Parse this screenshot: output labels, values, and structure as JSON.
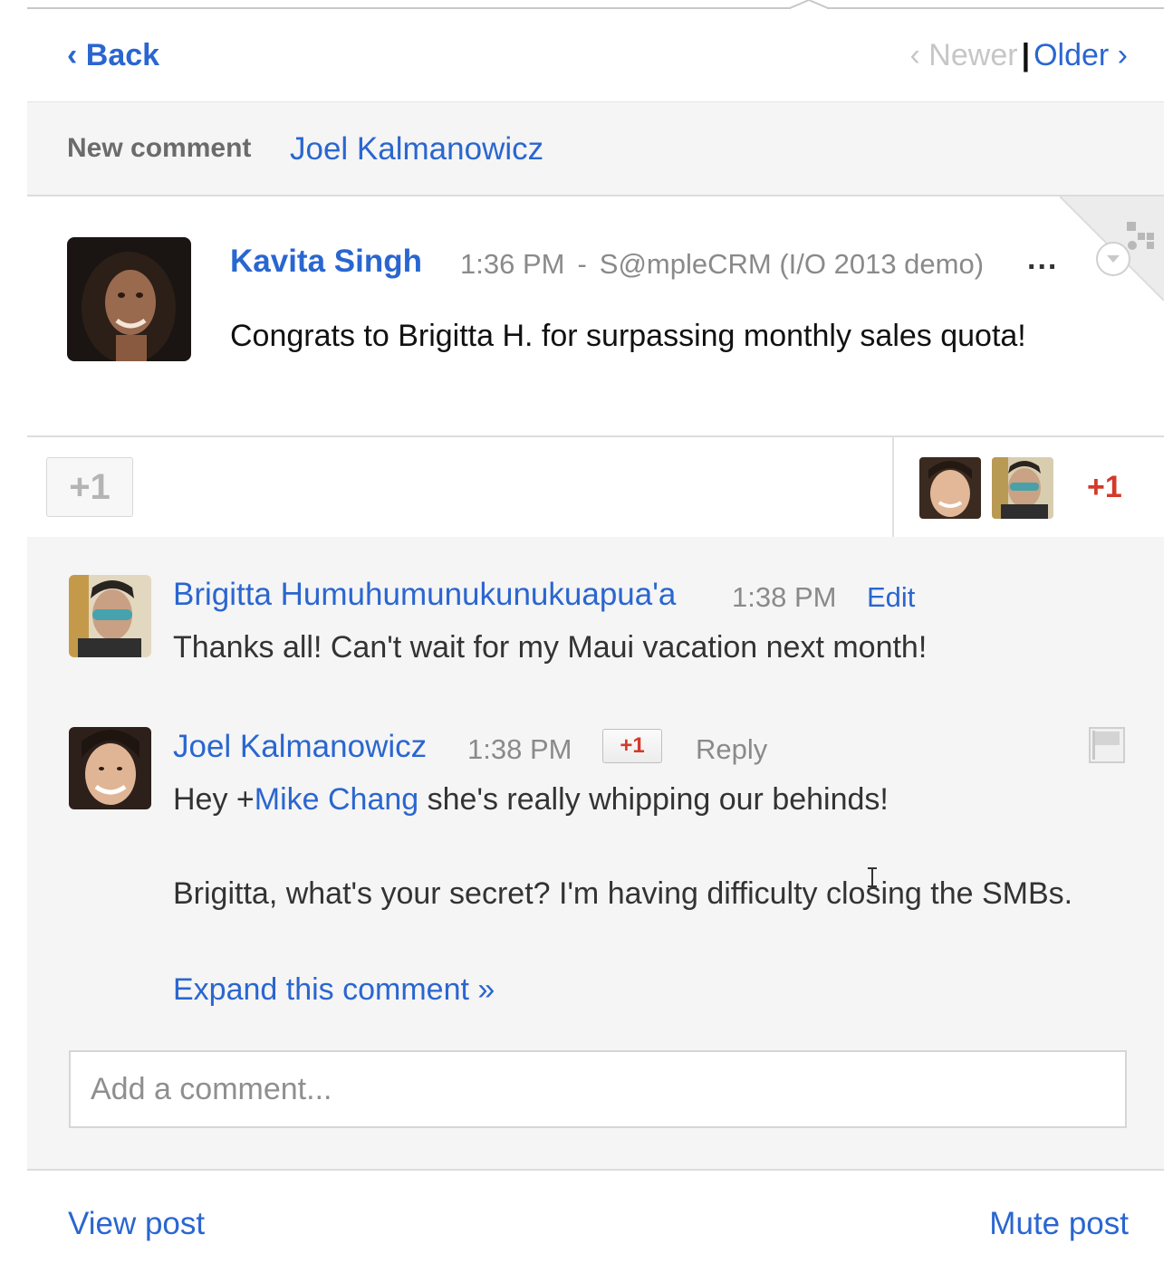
{
  "nav": {
    "back_label": "‹ Back",
    "newer_label": "‹ Newer",
    "separator": "|",
    "older_label": "Older ›"
  },
  "notification": {
    "label": "New comment",
    "name": "Joel Kalmanowicz"
  },
  "post": {
    "author": "Kavita Singh",
    "time": "1:36 PM",
    "dash": "-",
    "community": "S@mpleCRM (I/O 2013 demo)",
    "more": "...",
    "text": "Congrats to Brigitta H. for surpassing monthly sales quota!"
  },
  "plus_bar": {
    "button_label": "+1",
    "count_label": "+1"
  },
  "comments": [
    {
      "author": "Brigitta Humuhumunukunukuapua'a",
      "time": "1:38 PM",
      "action": "Edit",
      "text": "Thanks all! Can't wait for my Maui vacation next month!"
    },
    {
      "author": "Joel Kalmanowicz",
      "time": "1:38 PM",
      "plus_label": "+1",
      "action": "Reply",
      "text_prefix": "Hey +",
      "mention": "Mike Chang",
      "text_suffix": " she's really whipping our behinds!",
      "text_line2": "Brigitta, what's your secret? I'm having difficulty closing the SMBs.",
      "expand": "Expand this comment »"
    }
  ],
  "add_comment": {
    "placeholder": "Add a comment..."
  },
  "footer": {
    "view_post": "View post",
    "mute_post": "Mute post"
  },
  "colors": {
    "link": "#2a66d0",
    "plus_red": "#d23a2a",
    "muted_gray": "#8a8a8a",
    "panel_bg": "#f5f5f5"
  }
}
